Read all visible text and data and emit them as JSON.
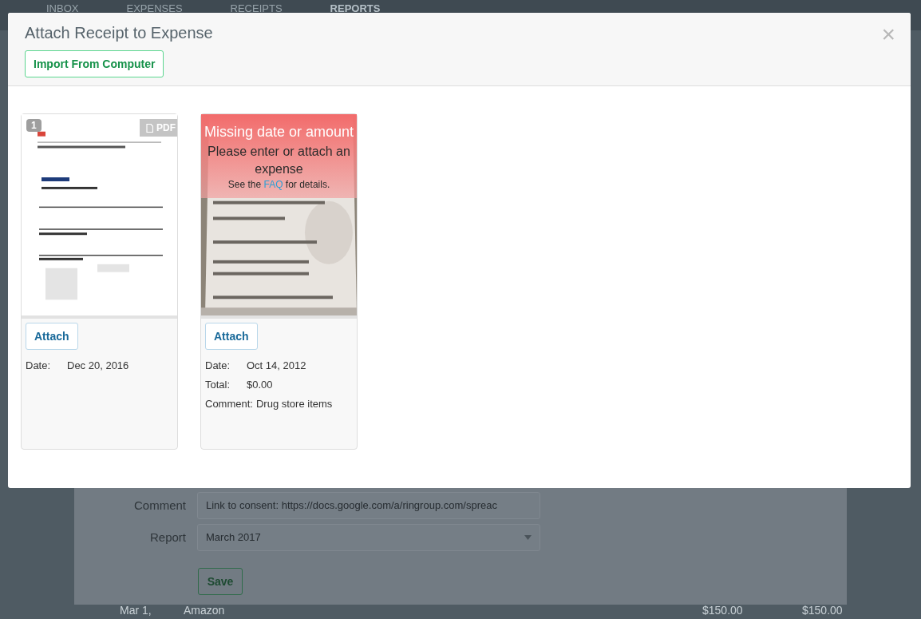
{
  "nav": {
    "tabs": [
      {
        "label": "INBOX",
        "selected": false
      },
      {
        "label": "EXPENSES",
        "selected": false
      },
      {
        "label": "RECEIPTS",
        "selected": false
      },
      {
        "label": "REPORTS",
        "selected": true
      }
    ]
  },
  "background_form": {
    "fields": [
      {
        "label": "Comment",
        "value": "Link to consent: https://docs.google.com/a/ringroup.com/spreac",
        "kind": "text"
      },
      {
        "label": "Report",
        "value": "March 2017",
        "kind": "select"
      }
    ],
    "save_button": "Save"
  },
  "background_row": {
    "date": "Mar 1,",
    "merchant": "Amazon",
    "amount": "$150.00",
    "total": "$150.00"
  },
  "modal": {
    "title": "Attach Receipt to Expense",
    "import_button": "Import From Computer",
    "close": "×",
    "receipts": [
      {
        "kind": "document",
        "badge": "1",
        "file_type": "PDF",
        "attach": "Attach",
        "details": [
          {
            "label": "Date:",
            "value": "Dec 20, 2016"
          }
        ]
      },
      {
        "attach": "Attach",
        "warning": {
          "title": "Missing date or amount",
          "message": "Please enter or attach an expense",
          "hint_before": "See the",
          "link": "FAQ",
          "hint_after": "for details."
        },
        "details": [
          {
            "label": "Date:",
            "value": "Oct 14, 2012"
          },
          {
            "label": "Total:",
            "value": "$0.00"
          },
          {
            "label": "Comment:",
            "value": "Drug store items"
          }
        ]
      }
    ]
  }
}
